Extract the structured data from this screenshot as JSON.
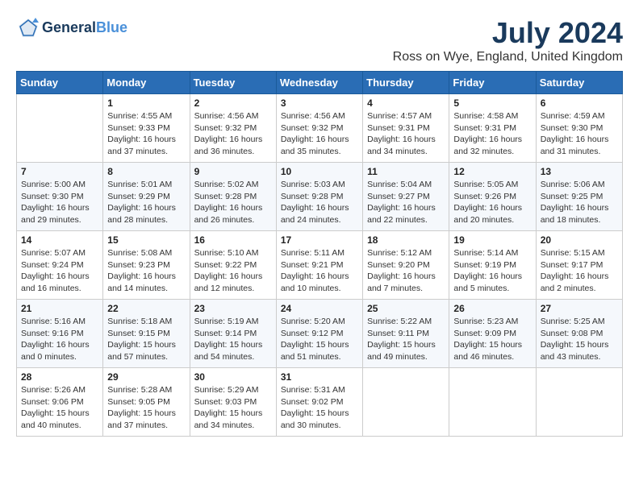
{
  "logo": {
    "line1": "General",
    "line2": "Blue"
  },
  "title": "July 2024",
  "location": "Ross on Wye, England, United Kingdom",
  "weekdays": [
    "Sunday",
    "Monday",
    "Tuesday",
    "Wednesday",
    "Thursday",
    "Friday",
    "Saturday"
  ],
  "weeks": [
    [
      {
        "day": "",
        "info": ""
      },
      {
        "day": "1",
        "info": "Sunrise: 4:55 AM\nSunset: 9:33 PM\nDaylight: 16 hours\nand 37 minutes."
      },
      {
        "day": "2",
        "info": "Sunrise: 4:56 AM\nSunset: 9:32 PM\nDaylight: 16 hours\nand 36 minutes."
      },
      {
        "day": "3",
        "info": "Sunrise: 4:56 AM\nSunset: 9:32 PM\nDaylight: 16 hours\nand 35 minutes."
      },
      {
        "day": "4",
        "info": "Sunrise: 4:57 AM\nSunset: 9:31 PM\nDaylight: 16 hours\nand 34 minutes."
      },
      {
        "day": "5",
        "info": "Sunrise: 4:58 AM\nSunset: 9:31 PM\nDaylight: 16 hours\nand 32 minutes."
      },
      {
        "day": "6",
        "info": "Sunrise: 4:59 AM\nSunset: 9:30 PM\nDaylight: 16 hours\nand 31 minutes."
      }
    ],
    [
      {
        "day": "7",
        "info": "Sunrise: 5:00 AM\nSunset: 9:30 PM\nDaylight: 16 hours\nand 29 minutes."
      },
      {
        "day": "8",
        "info": "Sunrise: 5:01 AM\nSunset: 9:29 PM\nDaylight: 16 hours\nand 28 minutes."
      },
      {
        "day": "9",
        "info": "Sunrise: 5:02 AM\nSunset: 9:28 PM\nDaylight: 16 hours\nand 26 minutes."
      },
      {
        "day": "10",
        "info": "Sunrise: 5:03 AM\nSunset: 9:28 PM\nDaylight: 16 hours\nand 24 minutes."
      },
      {
        "day": "11",
        "info": "Sunrise: 5:04 AM\nSunset: 9:27 PM\nDaylight: 16 hours\nand 22 minutes."
      },
      {
        "day": "12",
        "info": "Sunrise: 5:05 AM\nSunset: 9:26 PM\nDaylight: 16 hours\nand 20 minutes."
      },
      {
        "day": "13",
        "info": "Sunrise: 5:06 AM\nSunset: 9:25 PM\nDaylight: 16 hours\nand 18 minutes."
      }
    ],
    [
      {
        "day": "14",
        "info": "Sunrise: 5:07 AM\nSunset: 9:24 PM\nDaylight: 16 hours\nand 16 minutes."
      },
      {
        "day": "15",
        "info": "Sunrise: 5:08 AM\nSunset: 9:23 PM\nDaylight: 16 hours\nand 14 minutes."
      },
      {
        "day": "16",
        "info": "Sunrise: 5:10 AM\nSunset: 9:22 PM\nDaylight: 16 hours\nand 12 minutes."
      },
      {
        "day": "17",
        "info": "Sunrise: 5:11 AM\nSunset: 9:21 PM\nDaylight: 16 hours\nand 10 minutes."
      },
      {
        "day": "18",
        "info": "Sunrise: 5:12 AM\nSunset: 9:20 PM\nDaylight: 16 hours\nand 7 minutes."
      },
      {
        "day": "19",
        "info": "Sunrise: 5:14 AM\nSunset: 9:19 PM\nDaylight: 16 hours\nand 5 minutes."
      },
      {
        "day": "20",
        "info": "Sunrise: 5:15 AM\nSunset: 9:17 PM\nDaylight: 16 hours\nand 2 minutes."
      }
    ],
    [
      {
        "day": "21",
        "info": "Sunrise: 5:16 AM\nSunset: 9:16 PM\nDaylight: 16 hours\nand 0 minutes."
      },
      {
        "day": "22",
        "info": "Sunrise: 5:18 AM\nSunset: 9:15 PM\nDaylight: 15 hours\nand 57 minutes."
      },
      {
        "day": "23",
        "info": "Sunrise: 5:19 AM\nSunset: 9:14 PM\nDaylight: 15 hours\nand 54 minutes."
      },
      {
        "day": "24",
        "info": "Sunrise: 5:20 AM\nSunset: 9:12 PM\nDaylight: 15 hours\nand 51 minutes."
      },
      {
        "day": "25",
        "info": "Sunrise: 5:22 AM\nSunset: 9:11 PM\nDaylight: 15 hours\nand 49 minutes."
      },
      {
        "day": "26",
        "info": "Sunrise: 5:23 AM\nSunset: 9:09 PM\nDaylight: 15 hours\nand 46 minutes."
      },
      {
        "day": "27",
        "info": "Sunrise: 5:25 AM\nSunset: 9:08 PM\nDaylight: 15 hours\nand 43 minutes."
      }
    ],
    [
      {
        "day": "28",
        "info": "Sunrise: 5:26 AM\nSunset: 9:06 PM\nDaylight: 15 hours\nand 40 minutes."
      },
      {
        "day": "29",
        "info": "Sunrise: 5:28 AM\nSunset: 9:05 PM\nDaylight: 15 hours\nand 37 minutes."
      },
      {
        "day": "30",
        "info": "Sunrise: 5:29 AM\nSunset: 9:03 PM\nDaylight: 15 hours\nand 34 minutes."
      },
      {
        "day": "31",
        "info": "Sunrise: 5:31 AM\nSunset: 9:02 PM\nDaylight: 15 hours\nand 30 minutes."
      },
      {
        "day": "",
        "info": ""
      },
      {
        "day": "",
        "info": ""
      },
      {
        "day": "",
        "info": ""
      }
    ]
  ]
}
